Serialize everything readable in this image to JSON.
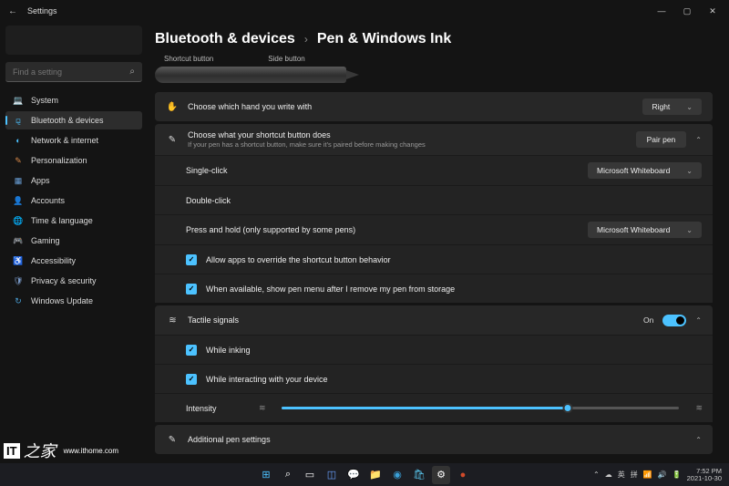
{
  "window": {
    "title": "Settings",
    "minimize": "—",
    "maximize": "▢",
    "close": "✕"
  },
  "search": {
    "placeholder": "Find a setting"
  },
  "nav": {
    "system": "System",
    "bluetooth": "Bluetooth & devices",
    "network": "Network & internet",
    "personalization": "Personalization",
    "apps": "Apps",
    "accounts": "Accounts",
    "time": "Time & language",
    "gaming": "Gaming",
    "accessibility": "Accessibility",
    "privacy": "Privacy & security",
    "update": "Windows Update"
  },
  "breadcrumb": {
    "parent": "Bluetooth & devices",
    "sep": "›",
    "current": "Pen & Windows Ink"
  },
  "pen_labels": {
    "shortcut": "Shortcut button",
    "side": "Side button"
  },
  "rows": {
    "hand": {
      "label": "Choose which hand you write with",
      "value": "Right"
    },
    "shortcut": {
      "label": "Choose what your shortcut button does",
      "sub": "If your pen has a shortcut button, make sure it's paired before making changes",
      "pair": "Pair pen"
    },
    "single": {
      "label": "Single-click",
      "value": "Microsoft Whiteboard"
    },
    "double": {
      "label": "Double-click"
    },
    "hold": {
      "label": "Press and hold (only supported by some pens)",
      "value": "Microsoft Whiteboard"
    },
    "override": {
      "label": "Allow apps to override the shortcut button behavior"
    },
    "penmenu": {
      "label": "When available, show pen menu after I remove my pen from storage"
    },
    "tactile": {
      "label": "Tactile signals",
      "state": "On"
    },
    "inking": {
      "label": "While inking"
    },
    "interacting": {
      "label": "While interacting with your device"
    },
    "intensity": {
      "label": "Intensity"
    },
    "additional": {
      "label": "Additional pen settings"
    }
  },
  "tray": {
    "lang1": "英",
    "lang2": "拼",
    "time": "7:52 PM",
    "date": "2021-10-30"
  },
  "watermark": {
    "it": "IT",
    "zhi": "之家",
    "url": "www.ithome.com"
  }
}
